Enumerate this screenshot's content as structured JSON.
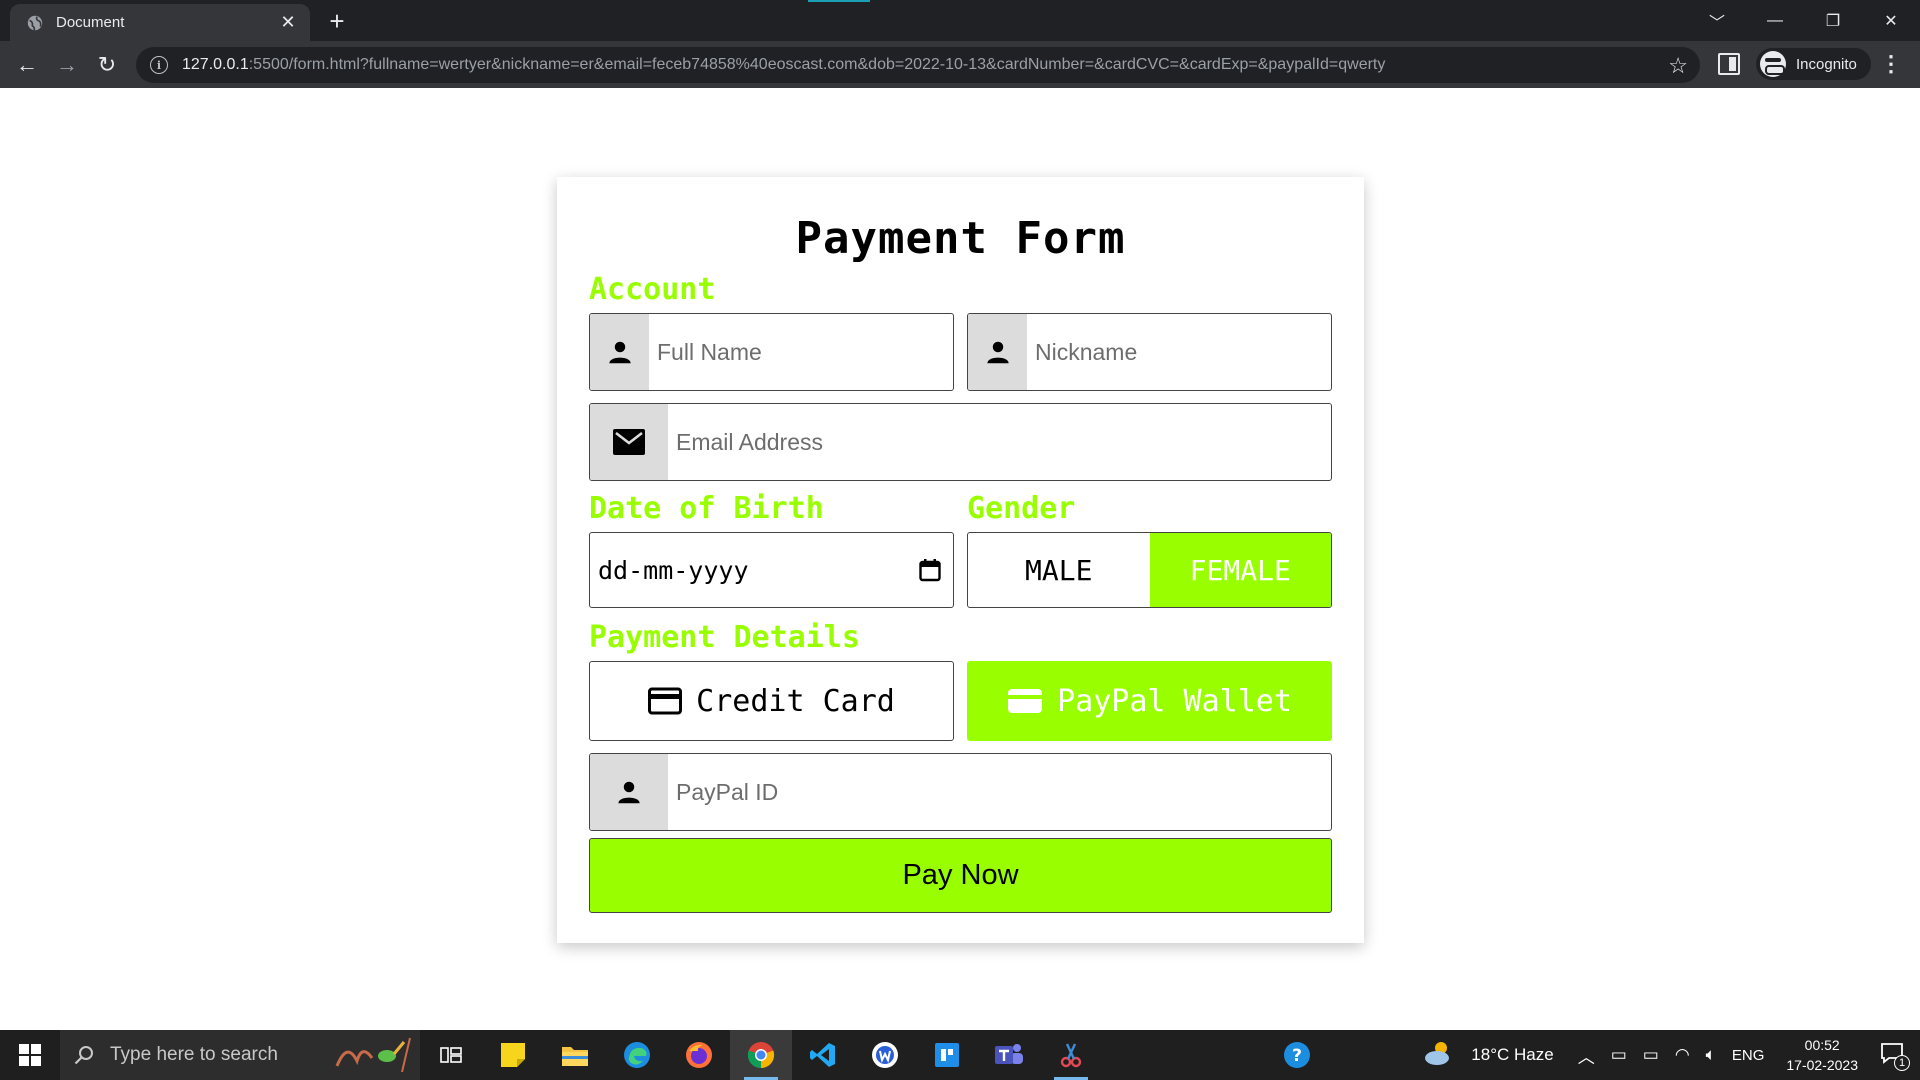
{
  "browser": {
    "tab_title": "Document",
    "new_tab_label": "+",
    "url_host": "127.0.0.1",
    "url_rest": ":5500/form.html?fullname=wertyer&nickname=er&email=feceb74858%40eoscast.com&dob=2022-10-13&cardNumber=&cardCVC=&cardExp=&paypalId=qwerty",
    "profile_label": "Incognito"
  },
  "form": {
    "title": "Payment Form",
    "account_label": "Account",
    "fullname_placeholder": "Full Name",
    "nickname_placeholder": "Nickname",
    "email_placeholder": "Email Address",
    "dob_label": "Date of Birth",
    "dob_placeholder": "dd-mm-yyyy",
    "gender_label": "Gender",
    "gender_male": "MALE",
    "gender_female": "FEMALE",
    "gender_selected": "FEMALE",
    "payment_label": "Payment Details",
    "credit_card_label": "Credit Card",
    "paypal_label": "PayPal Wallet",
    "payment_selected": "PayPal Wallet",
    "paypal_id_placeholder": "PayPal ID",
    "submit_label": "Pay Now"
  },
  "taskbar": {
    "search_placeholder": "Type here to search",
    "weather": "18°C  Haze",
    "language": "ENG",
    "time": "00:52",
    "date": "17-02-2023",
    "notification_count": "1"
  },
  "colors": {
    "accent_green": "#99ff00",
    "chrome_dark": "#202124",
    "chrome_toolbar": "#35363a"
  }
}
